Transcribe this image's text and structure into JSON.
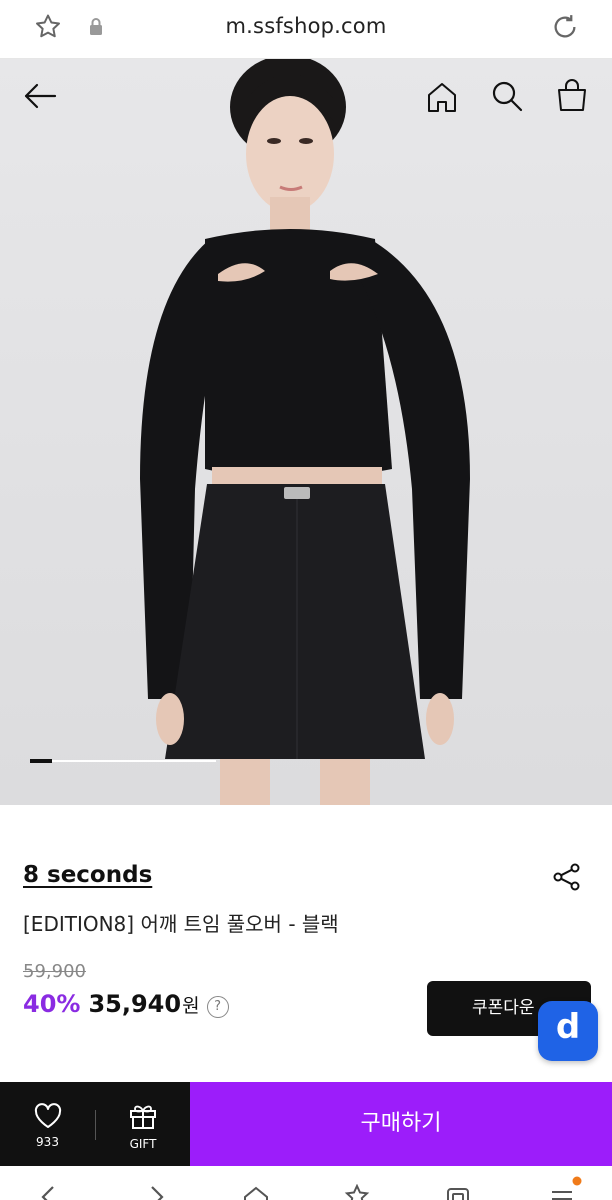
{
  "browser": {
    "url": "m.ssfshop.com",
    "icons": [
      "star-icon",
      "lock-icon",
      "reload-icon"
    ]
  },
  "header": {
    "icons": [
      "back-arrow-icon",
      "home-icon",
      "search-icon",
      "shopping-bag-icon"
    ]
  },
  "gallery": {
    "progress": 0.12
  },
  "product": {
    "brand": "8 seconds",
    "name": "[EDITION8] 어깨 트임 풀오버 - 블랙",
    "original_price": "59,900",
    "discount": "40%",
    "sale_price": "35,940",
    "currency": "원",
    "help_icon": "?"
  },
  "coupon": {
    "label": "쿠폰다운"
  },
  "floating_badge": {
    "label": "d"
  },
  "action_bar": {
    "like_count": "933",
    "gift_label": "GIFT",
    "buy_label": "구매하기"
  },
  "colors": {
    "accent_purple": "#9c1dfa",
    "discount_purple": "#8a2be2",
    "badge_blue": "#1f63e6",
    "dark": "#111111"
  }
}
